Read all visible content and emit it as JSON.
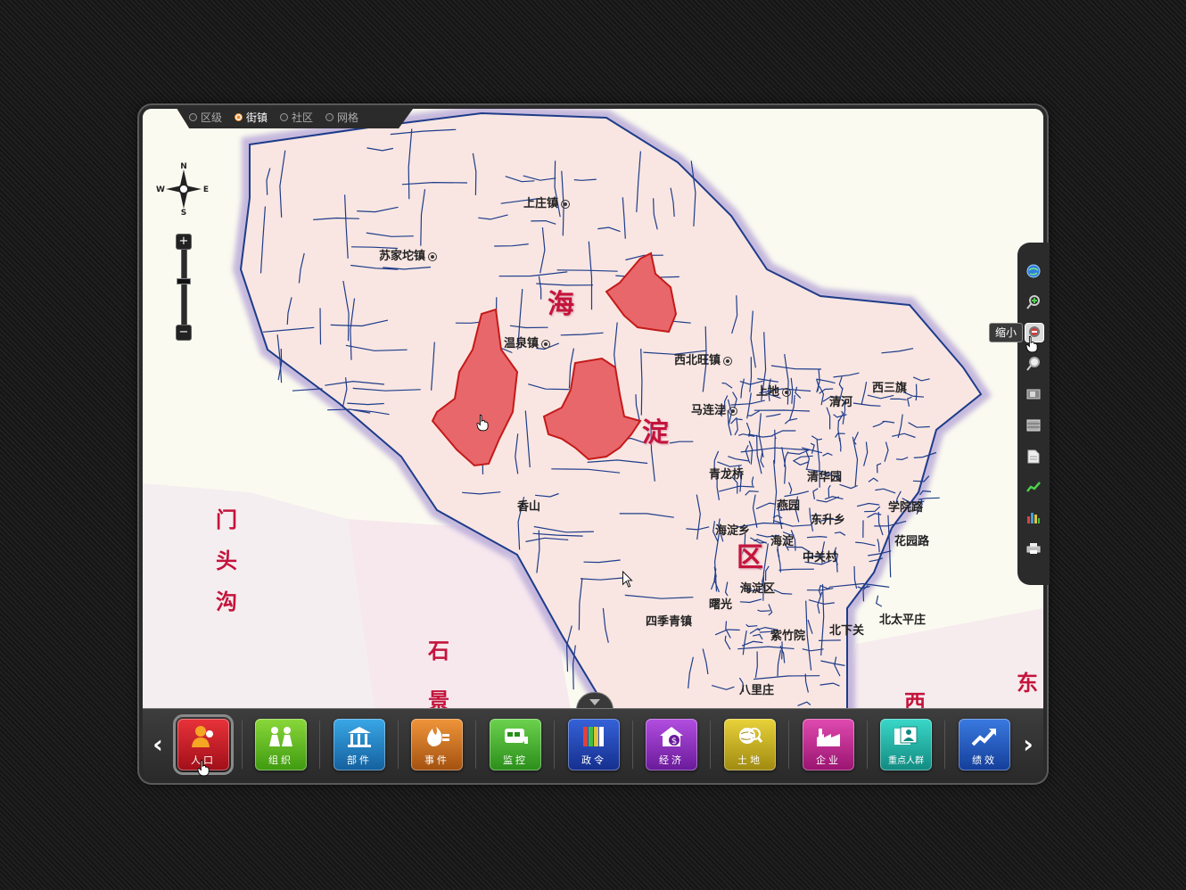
{
  "level_selector": {
    "options": [
      {
        "label": "区级",
        "selected": false
      },
      {
        "label": "街镇",
        "selected": true
      },
      {
        "label": "社区",
        "selected": false
      },
      {
        "label": "网格",
        "selected": false
      }
    ]
  },
  "compass": {
    "n": "N",
    "s": "S",
    "e": "E",
    "w": "W"
  },
  "zoom": {
    "plus": "+",
    "minus": "−"
  },
  "map": {
    "places": [
      {
        "name": "上庄镇"
      },
      {
        "name": "苏家坨镇"
      },
      {
        "name": "温泉镇"
      },
      {
        "name": "西北旺镇"
      },
      {
        "name": "马连洼"
      },
      {
        "name": "上地"
      },
      {
        "name": "清河"
      },
      {
        "name": "西三旗"
      },
      {
        "name": "香山"
      },
      {
        "name": "青龙桥"
      },
      {
        "name": "清华园"
      },
      {
        "name": "燕园"
      },
      {
        "name": "东升乡"
      },
      {
        "name": "学院路"
      },
      {
        "name": "海淀乡"
      },
      {
        "name": "海淀"
      },
      {
        "name": "花园路"
      },
      {
        "name": "中关村"
      },
      {
        "name": "海淀区"
      },
      {
        "name": "曙光"
      },
      {
        "name": "四季青镇"
      },
      {
        "name": "紫竹院"
      },
      {
        "name": "北下关"
      },
      {
        "name": "北太平庄"
      },
      {
        "name": "八里庄"
      }
    ],
    "district_chars": [
      "海",
      "淀",
      "区"
    ],
    "neighbors": {
      "mentougou": "门头沟",
      "shijingshan": "石景",
      "xi": "西",
      "dong": "东"
    }
  },
  "right_toolbar": {
    "tooltip": "缩小",
    "tools": [
      "globe-icon",
      "zoom-in-icon",
      "zoom-out-icon",
      "magnifier-icon",
      "layer-icon",
      "table-icon",
      "document-icon",
      "trend-icon",
      "bar-chart-icon",
      "printer-icon"
    ]
  },
  "modules": [
    {
      "label": "人口",
      "color_top": "#e8323a",
      "color_bottom": "#a10f19",
      "icon": "person-icon"
    },
    {
      "label": "组织",
      "color_top": "#8ad83a",
      "color_bottom": "#3f9a10",
      "icon": "group-icon"
    },
    {
      "label": "部件",
      "color_top": "#3aa7e6",
      "color_bottom": "#14609e",
      "icon": "building-icon"
    },
    {
      "label": "事件",
      "color_top": "#f0953a",
      "color_bottom": "#a35110",
      "icon": "fire-icon"
    },
    {
      "label": "监控",
      "color_top": "#6cd24e",
      "color_bottom": "#2a8e1a",
      "icon": "monitor-icon"
    },
    {
      "label": "政令",
      "color_top": "#3562d8",
      "color_bottom": "#152f8e",
      "icon": "books-icon"
    },
    {
      "label": "经济",
      "color_top": "#b24ee0",
      "color_bottom": "#6a1a9a",
      "icon": "money-house-icon"
    },
    {
      "label": "土地",
      "color_top": "#e8d23a",
      "color_bottom": "#a08a10",
      "icon": "globe-search-icon"
    },
    {
      "label": "企业",
      "color_top": "#e04ab0",
      "color_bottom": "#9a1470",
      "icon": "factory-icon"
    },
    {
      "label": "重点人群",
      "color_top": "#3ad8c8",
      "color_bottom": "#128a80",
      "icon": "profile-icon"
    },
    {
      "label": "绩效",
      "color_top": "#3a7ae0",
      "color_bottom": "#143e9a",
      "icon": "growth-icon"
    }
  ],
  "nav": {
    "prev": "‹",
    "next": "›"
  },
  "colors": {
    "highlight": "#e8676a",
    "highlight_stroke": "#c41a1a",
    "boundary": "#1e3c8a",
    "land": "#f9e6e2",
    "outside": "#fbfaf0"
  }
}
